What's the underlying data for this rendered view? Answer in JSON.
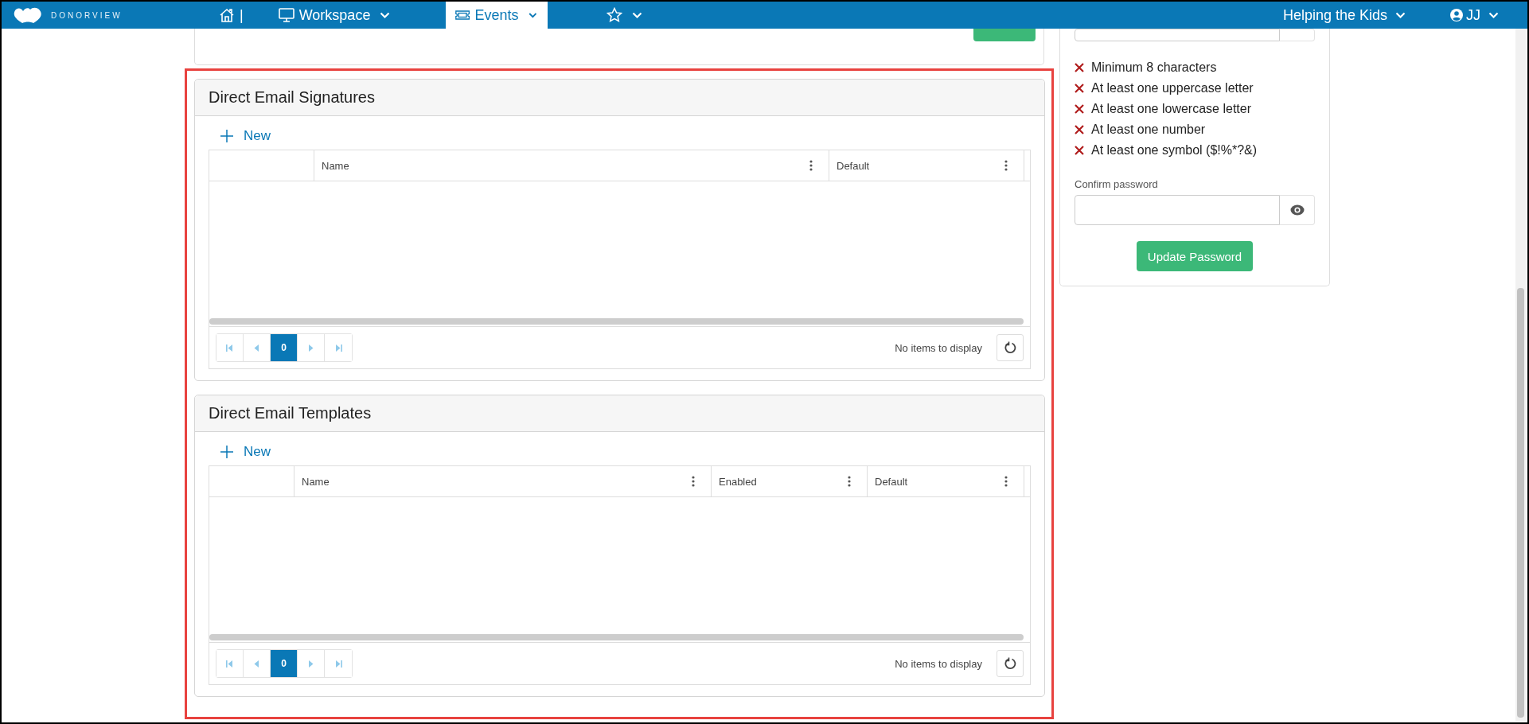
{
  "navbar": {
    "logo_text": "DONORVIEW",
    "separator": "|",
    "items": [
      {
        "kind": "home",
        "selected": false
      },
      {
        "kind": "workspace",
        "label": "Workspace",
        "selected": false
      },
      {
        "kind": "events",
        "label": "Events",
        "selected": true
      },
      {
        "kind": "favorites",
        "selected": false
      }
    ],
    "organization": "Helping the Kids",
    "user": "JJ"
  },
  "sections": [
    {
      "title": "Direct Email Signatures",
      "new_label": "New",
      "columns": [
        {
          "label": "Name"
        },
        {
          "label": "Default"
        }
      ],
      "pages": [
        {
          "label": "0",
          "selected": true
        }
      ],
      "status": "No items to display"
    },
    {
      "title": "Direct Email Templates",
      "new_label": "New",
      "columns": [
        {
          "label": "Name"
        },
        {
          "label": "Enabled"
        },
        {
          "label": "Default"
        }
      ],
      "pages": [
        {
          "label": "0",
          "selected": true
        }
      ],
      "status": "No items to display"
    }
  ],
  "password_panel": {
    "rules": [
      {
        "text": "Minimum 8 characters",
        "met": false
      },
      {
        "text": "At least one uppercase letter",
        "met": false
      },
      {
        "text": "At least one lowercase letter",
        "met": false
      },
      {
        "text": "At least one number",
        "met": false
      },
      {
        "text": "At least one symbol ($!%*?&)",
        "met": false
      }
    ],
    "confirm_label": "Confirm password",
    "button": "Update Password"
  }
}
